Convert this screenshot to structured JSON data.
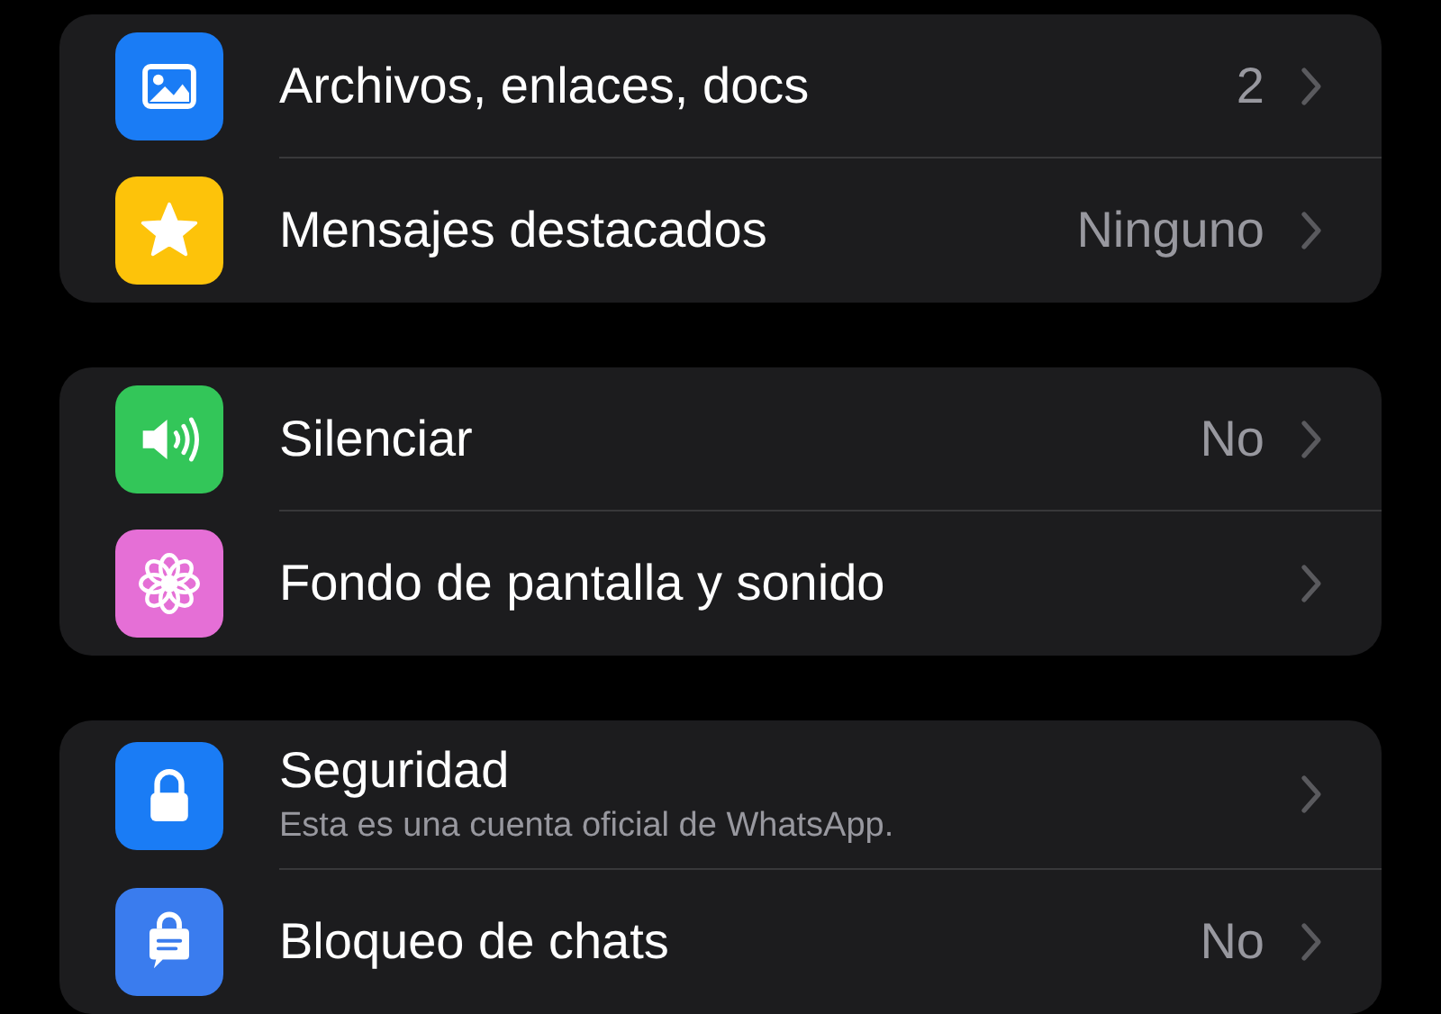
{
  "groups": [
    {
      "items": [
        {
          "kind": "photo",
          "color": "#1a7cf5",
          "label": "Archivos, enlaces, docs",
          "value": "2"
        },
        {
          "kind": "star",
          "color": "#fdc30a",
          "label": "Mensajes destacados",
          "value": "Ninguno"
        }
      ]
    },
    {
      "items": [
        {
          "kind": "speaker",
          "color": "#33c659",
          "label": "Silenciar",
          "value": "No"
        },
        {
          "kind": "flower",
          "color": "#e56fd6",
          "label": "Fondo de pantalla y sonido"
        }
      ]
    },
    {
      "items": [
        {
          "kind": "lock",
          "color": "#1a7cf5",
          "label": "Seguridad",
          "subtitle": "Esta es una cuenta oficial de WhatsApp."
        },
        {
          "kind": "chatlock",
          "color": "#3a7cee",
          "label": "Bloqueo de chats",
          "value": "No"
        }
      ]
    }
  ]
}
